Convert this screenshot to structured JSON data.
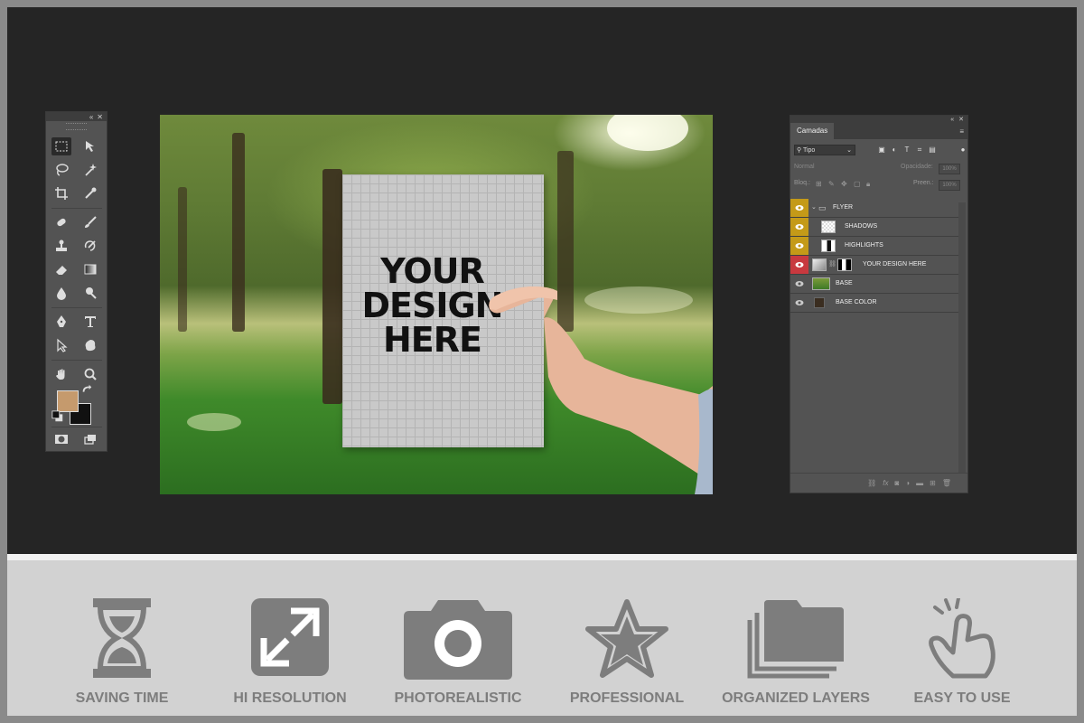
{
  "colors": {
    "workspace_bg": "#252525",
    "panel_bg": "#535353",
    "foreground_color": "#c59a6d",
    "background_color": "#111111",
    "layer_eye_yellow": "#c49a18",
    "layer_eye_red": "#c8393f",
    "feature_gray": "#7d7d7d"
  },
  "canvas": {
    "mockup_text": "YOUR DESIGN HERE"
  },
  "tools_panel": {
    "tools": [
      "marquee-icon",
      "move-icon",
      "lasso-icon",
      "magic-wand-icon",
      "crop-icon",
      "eyedropper-icon",
      "healing-icon",
      "brush-icon",
      "stamp-icon",
      "history-brush-icon",
      "eraser-icon",
      "gradient-icon",
      "blur-icon",
      "dodge-icon",
      "pen-icon",
      "type-icon",
      "path-select-icon",
      "shape-icon",
      "hand-icon",
      "zoom-icon",
      "quick-mask-icon",
      "screen-mode-icon"
    ]
  },
  "layers_panel": {
    "tab_label": "Camadas",
    "filter_value": "Tipo",
    "blend_mode": "Normal",
    "opacity_label": "Opacidade:",
    "opacity_value": "100%",
    "lock_label": "Bloq.:",
    "fill_label": "Preen.:",
    "fill_value": "100%",
    "layers": [
      {
        "name": "FLYER",
        "eye": "yellow",
        "kind": "group"
      },
      {
        "name": "SHADOWS",
        "eye": "yellow",
        "kind": "layer"
      },
      {
        "name": "HIGHLIGHTS",
        "eye": "yellow",
        "kind": "layer"
      },
      {
        "name": "YOUR DESIGN HERE",
        "eye": "red",
        "kind": "smart"
      },
      {
        "name": "BASE",
        "eye": "gray",
        "kind": "photo"
      },
      {
        "name": "BASE COLOR",
        "eye": "gray",
        "kind": "fill"
      }
    ]
  },
  "features": [
    {
      "label": "SAVING TIME",
      "icon": "hourglass-icon"
    },
    {
      "label": "HI RESOLUTION",
      "icon": "expand-icon"
    },
    {
      "label": "PHOTOREALISTIC",
      "icon": "camera-icon"
    },
    {
      "label": "PROFESSIONAL",
      "icon": "star-icon"
    },
    {
      "label": "ORGANIZED LAYERS",
      "icon": "layers-icon"
    },
    {
      "label": "EASY TO USE",
      "icon": "tap-hand-icon"
    }
  ]
}
